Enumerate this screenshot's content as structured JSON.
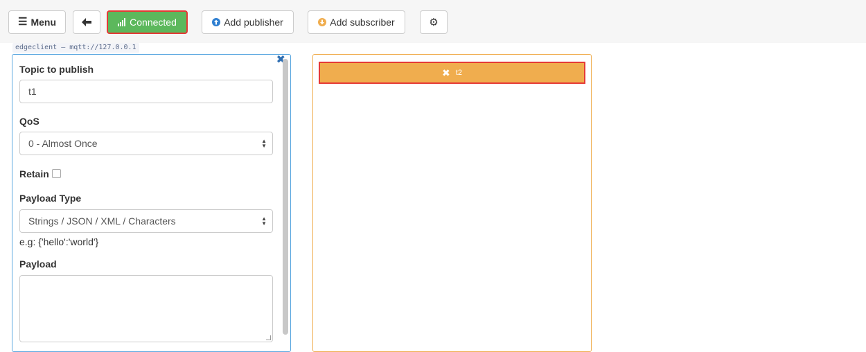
{
  "toolbar": {
    "menu_label": "Menu",
    "connected_label": "Connected",
    "add_publisher_label": "Add publisher",
    "add_subscriber_label": "Add subscriber"
  },
  "icons": {
    "menu": "hamburger-icon",
    "back": "arrow-left-icon",
    "signal": "signal-bars-icon",
    "publisher": "circle-arrow-up-icon",
    "subscriber": "circle-arrow-down-icon",
    "settings": "gear-icon",
    "close": "x-icon"
  },
  "connection": {
    "label": "edgeclient – mqtt://127.0.0.1"
  },
  "publisher": {
    "topic_label": "Topic to publish",
    "topic_value": "t1",
    "qos_label": "QoS",
    "qos_value": "0 - Almost Once",
    "retain_label": "Retain",
    "payload_type_label": "Payload Type",
    "payload_type_value": "Strings / JSON / XML / Characters",
    "payload_hint": "e.g: {'hello':'world'}",
    "payload_label": "Payload",
    "payload_value": ""
  },
  "subscriber": {
    "topic": "t2"
  },
  "colors": {
    "connected_bg": "#5cb85c",
    "subscriber_accent": "#f0ad4e",
    "publisher_border": "#5aa7e0",
    "highlight": "#e53935"
  }
}
